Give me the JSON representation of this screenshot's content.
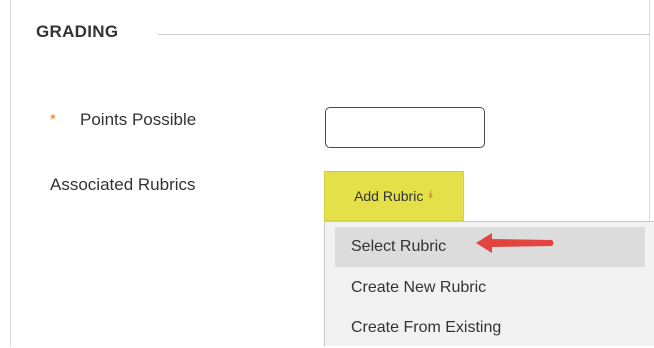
{
  "section": {
    "title": "GRADING"
  },
  "points": {
    "required_marker": "*",
    "label": "Points Possible",
    "value": ""
  },
  "rubrics": {
    "label": "Associated Rubrics",
    "add_button_label": "Add Rubric",
    "caret_icon": "double-chevron-down-icon",
    "menu": [
      {
        "label": "Select Rubric",
        "highlighted": true
      },
      {
        "label": "Create New Rubric",
        "highlighted": false
      },
      {
        "label": "Create From Existing",
        "highlighted": false
      }
    ]
  },
  "colors": {
    "button": "#e3e04a",
    "arrow": "#e2453f",
    "required": "#e07b20"
  }
}
